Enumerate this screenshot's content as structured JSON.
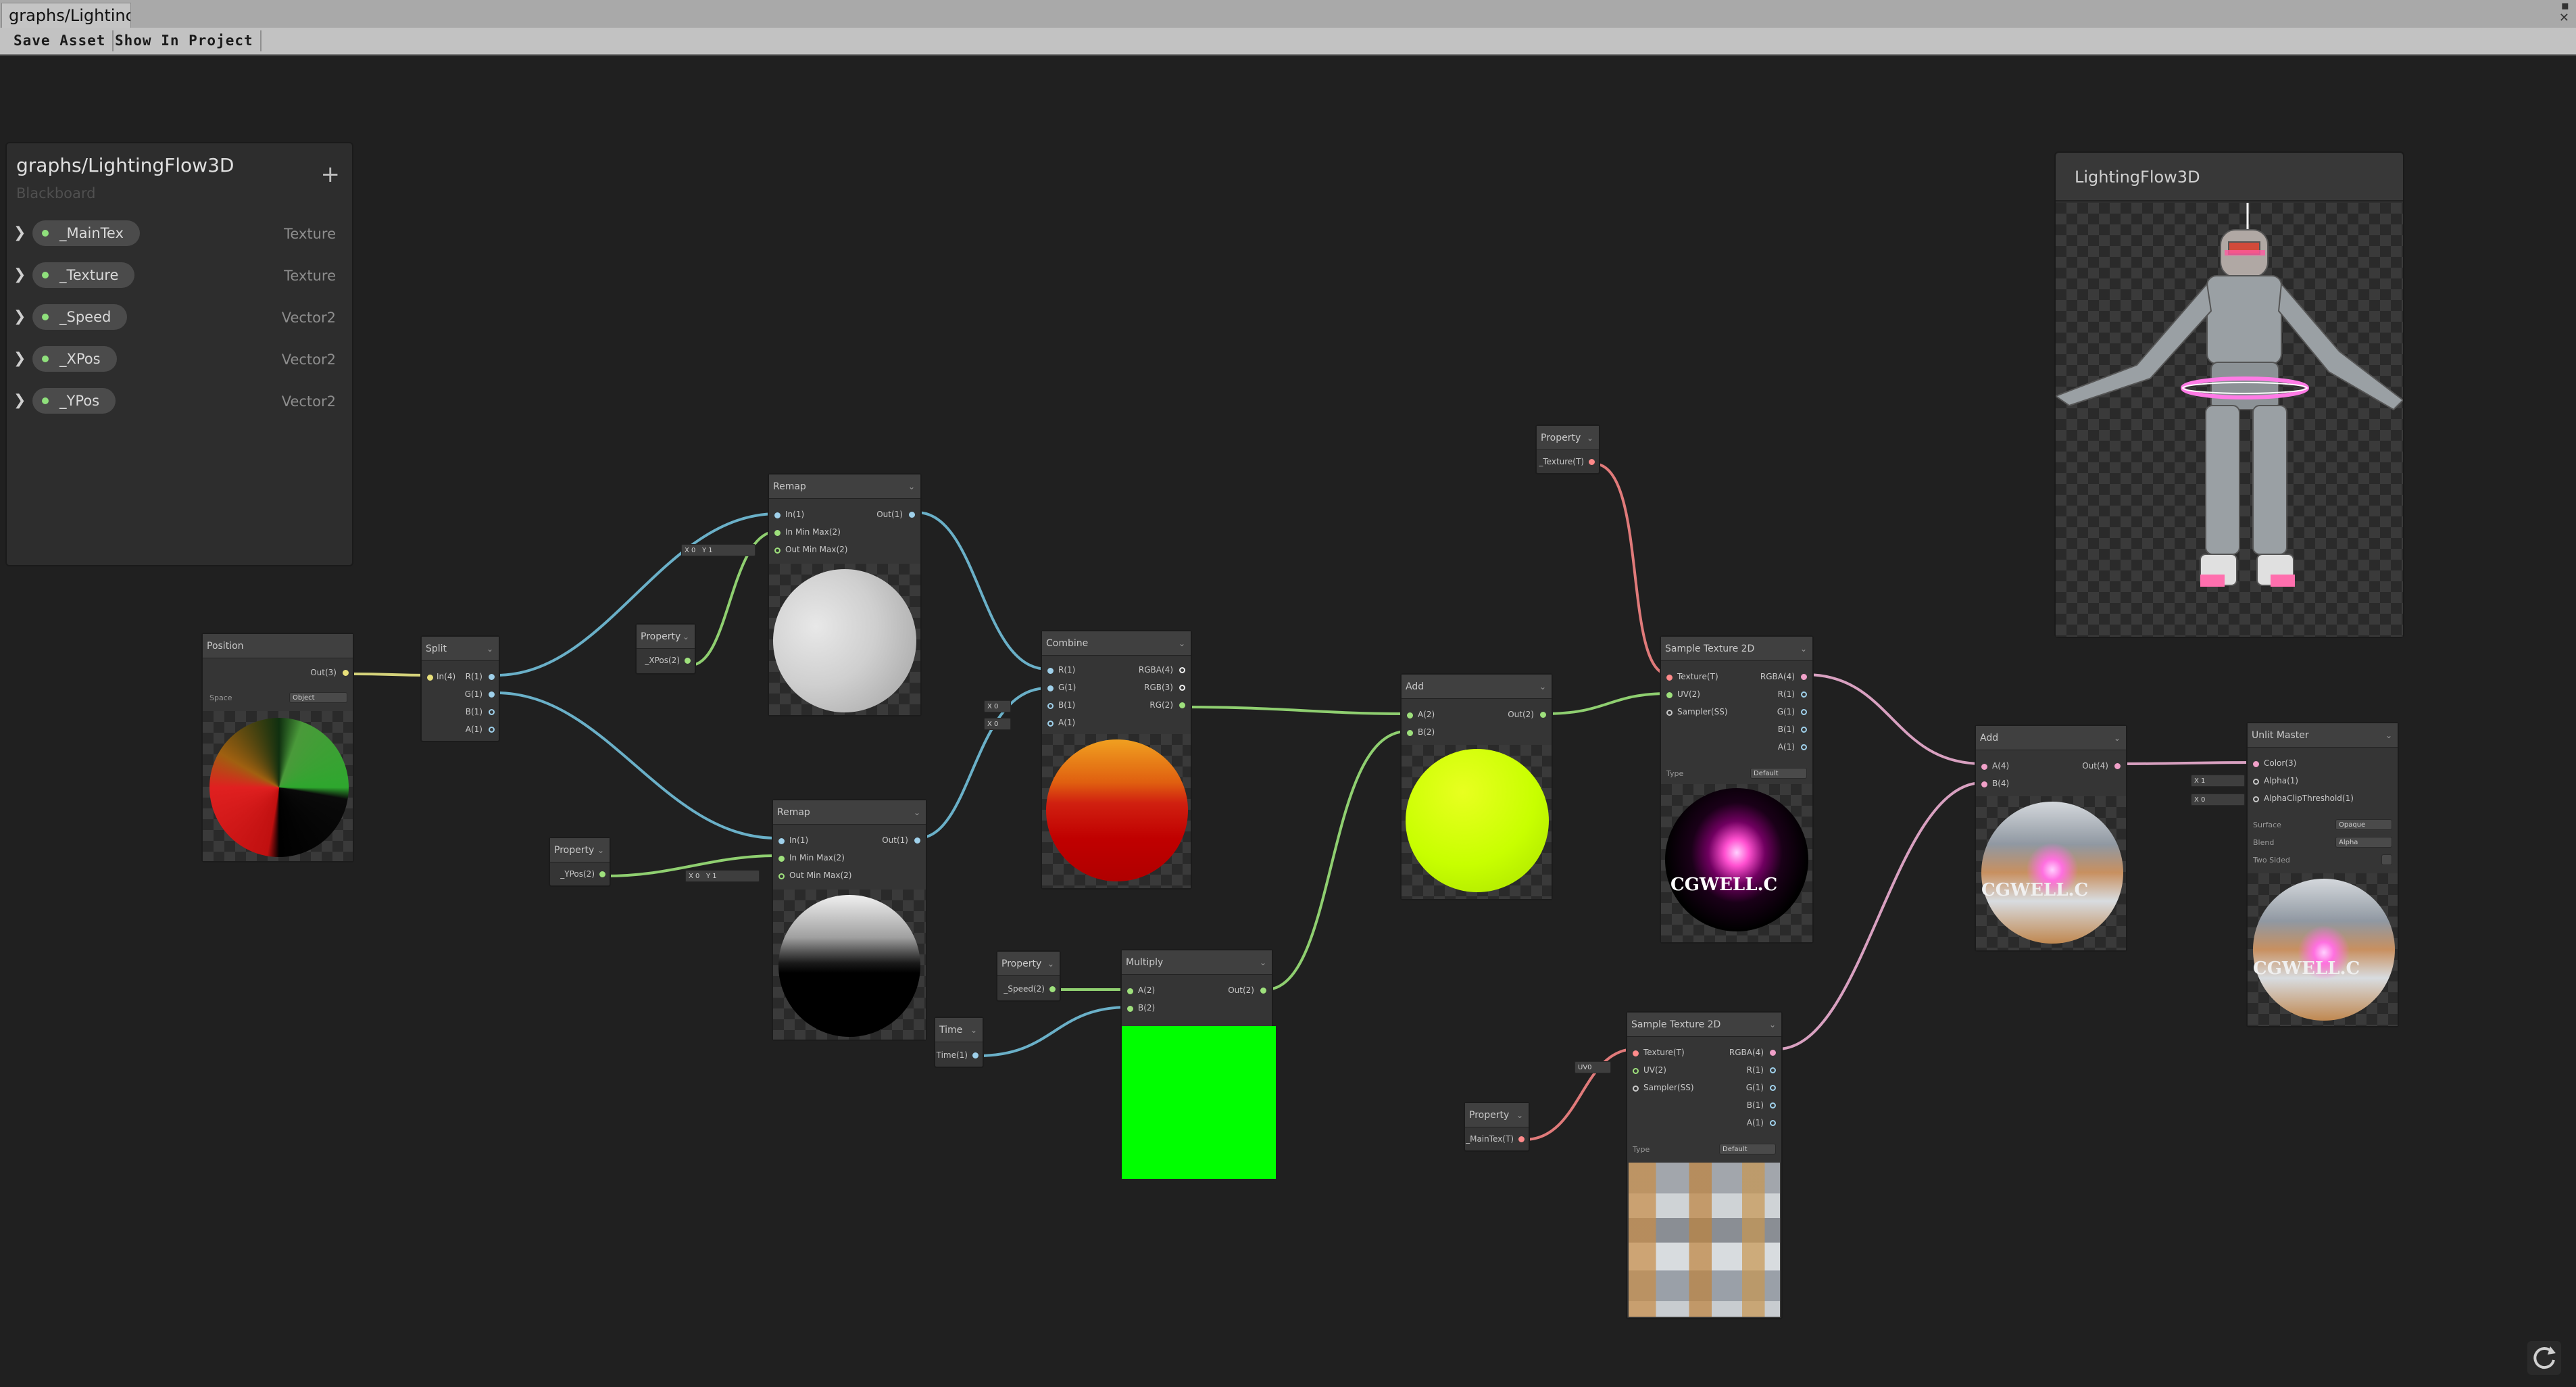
{
  "window": {
    "tab_title": "graphs/Lightinc"
  },
  "toolbar": {
    "save_asset": "Save Asset",
    "show_in_project": "Show In Project"
  },
  "blackboard": {
    "title": "graphs/LightingFlow3D",
    "subtitle": "Blackboard",
    "add_label": "+",
    "items": [
      {
        "name": "_MainTex",
        "type": "Texture"
      },
      {
        "name": "_Texture",
        "type": "Texture"
      },
      {
        "name": "_Speed",
        "type": "Vector2"
      },
      {
        "name": "_XPos",
        "type": "Vector2"
      },
      {
        "name": "_YPos",
        "type": "Vector2"
      }
    ]
  },
  "preview": {
    "title": "LightingFlow3D"
  },
  "nodes": {
    "position": {
      "title": "Position",
      "out": "Out(3)",
      "space_label": "Space",
      "space_value": "Object"
    },
    "split": {
      "title": "Split",
      "in": "In(4)",
      "r": "R(1)",
      "g": "G(1)",
      "b": "B(1)",
      "a": "A(1)"
    },
    "remap_top": {
      "title": "Remap",
      "in": "In(1)",
      "in_min_max": "In Min Max(2)",
      "out_min_max": "Out Min Max(2)",
      "out": "Out(1)",
      "x_val": "X 0",
      "y_val": "Y 1"
    },
    "remap_bottom": {
      "title": "Remap",
      "in": "In(1)",
      "in_min_max": "In Min Max(2)",
      "out_min_max": "Out Min Max(2)",
      "out": "Out(1)",
      "x_val": "X 0",
      "y_val": "Y 1"
    },
    "prop_xpos": {
      "title": "Property",
      "out": "_XPos(2)"
    },
    "prop_ypos": {
      "title": "Property",
      "out": "_YPos(2)"
    },
    "combine": {
      "title": "Combine",
      "r": "R(1)",
      "g": "G(1)",
      "b": "B(1)",
      "a": "A(1)",
      "rgba": "RGBA(4)",
      "rgb": "RGB(3)",
      "rg": "RG(2)",
      "b_val": "X 0",
      "a_val": "X 0"
    },
    "prop_speed": {
      "title": "Property",
      "out": "_Speed(2)"
    },
    "time": {
      "title": "Time",
      "out": "Time(1)"
    },
    "multiply": {
      "title": "Multiply",
      "a": "A(2)",
      "b": "B(2)",
      "out": "Out(2)"
    },
    "add1": {
      "title": "Add",
      "a": "A(2)",
      "b": "B(2)",
      "out": "Out(2)"
    },
    "prop_texture": {
      "title": "Property",
      "out": "_Texture(T)"
    },
    "sample1": {
      "title": "Sample Texture 2D",
      "texture": "Texture(T)",
      "uv": "UV(2)",
      "sampler": "Sampler(SS)",
      "rgba": "RGBA(4)",
      "r": "R(1)",
      "g": "G(1)",
      "b": "B(1)",
      "a": "A(1)",
      "type_label": "Type",
      "type_value": "Default"
    },
    "sample2": {
      "title": "Sample Texture 2D",
      "texture": "Texture(T)",
      "uv": "UV(2)",
      "sampler": "Sampler(SS)",
      "rgba": "RGBA(4)",
      "r": "R(1)",
      "g": "G(1)",
      "b": "B(1)",
      "a": "A(1)",
      "type_label": "Type",
      "type_value": "Default",
      "uv_val": "UV0"
    },
    "prop_maintex": {
      "title": "Property",
      "out": "_MainTex(T)"
    },
    "add2": {
      "title": "Add",
      "a": "A(4)",
      "b": "B(4)",
      "out": "Out(4)"
    },
    "unlit": {
      "title": "Unlit Master",
      "color": "Color(3)",
      "alpha": "Alpha(1)",
      "clip": "AlphaClipThreshold(1)",
      "alpha_val": "X 1",
      "clip_val": "X 0",
      "surface_label": "Surface",
      "surface_value": "Opaque",
      "blend_label": "Blend",
      "blend_value": "Alpha",
      "twosided_label": "Two Sided"
    }
  },
  "textures": {
    "lightning_text": "CGWELL.C",
    "sphere_text": "CGWELL.C"
  },
  "icons": {
    "refresh": "refresh-icon",
    "expand": "chevron-right-icon"
  }
}
